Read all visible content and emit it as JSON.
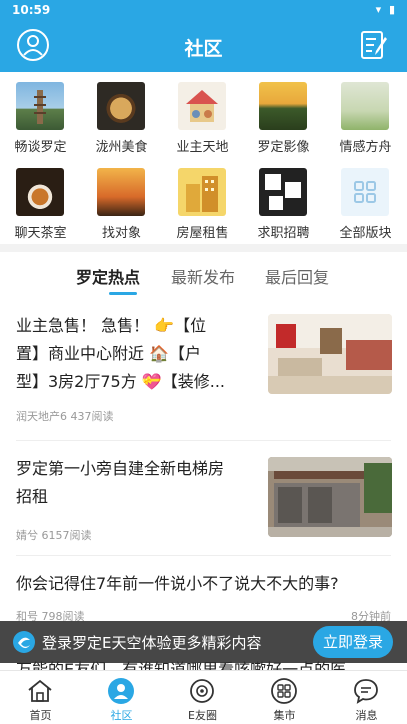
{
  "status_bar": {
    "time": "10:59",
    "icons": "▾ ▮"
  },
  "header": {
    "title": "社区",
    "left_icon": "user-avatar-icon",
    "right_icon": "compose-note-icon"
  },
  "categories": [
    {
      "label": "畅谈罗定",
      "icon": "pagoda-photo"
    },
    {
      "label": "泷州美食",
      "icon": "food-photo"
    },
    {
      "label": "业主天地",
      "icon": "family-house-photo"
    },
    {
      "label": "罗定影像",
      "icon": "sunset-photo"
    },
    {
      "label": "情感方舟",
      "icon": "couple-photo"
    },
    {
      "label": "聊天茶室",
      "icon": "tea-photo"
    },
    {
      "label": "找对象",
      "icon": "heart-hands-photo"
    },
    {
      "label": "房屋租售",
      "icon": "building-photo"
    },
    {
      "label": "求职招聘",
      "icon": "job-poster-photo"
    },
    {
      "label": "全部版块",
      "icon": "grid-all-icon"
    }
  ],
  "tabs": [
    {
      "label": "罗定热点",
      "active": true
    },
    {
      "label": "最新发布",
      "active": false
    },
    {
      "label": "最后回复",
      "active": false
    }
  ],
  "posts": [
    {
      "title_line1": "业主急售！ 急售！ 👉【位",
      "title_line2": "置】商业中心附近 🏠【户",
      "title_line3": "型】3房2厅75方 💝【装修...",
      "author": "润天地产6",
      "reads": "437阅读"
    },
    {
      "title_line1": "罗定第一小旁自建全新电梯房",
      "title_line2": "招租",
      "author": "婧兮",
      "reads": "6157阅读"
    },
    {
      "title_line1": "你会记得住7年前一件说小不了说大不大的事?",
      "author": "和号",
      "reads": "798阅读",
      "time": "8分钟前"
    }
  ],
  "peek_text": "万能的E友们，有谁知道哪里看咳嗽好一点的医",
  "login_banner": {
    "text": "登录罗定E天空体验更多精彩内容",
    "button": "立即登录"
  },
  "bottom_nav": [
    {
      "label": "首页",
      "icon": "home-icon",
      "active": false
    },
    {
      "label": "社区",
      "icon": "community-icon",
      "active": true
    },
    {
      "label": "E友圈",
      "icon": "friends-circle-icon",
      "active": false
    },
    {
      "label": "集市",
      "icon": "market-icon",
      "active": false
    },
    {
      "label": "消息",
      "icon": "message-icon",
      "active": false
    }
  ],
  "colors": {
    "accent": "#2aa7e4",
    "banner": "#2d2d2d"
  }
}
